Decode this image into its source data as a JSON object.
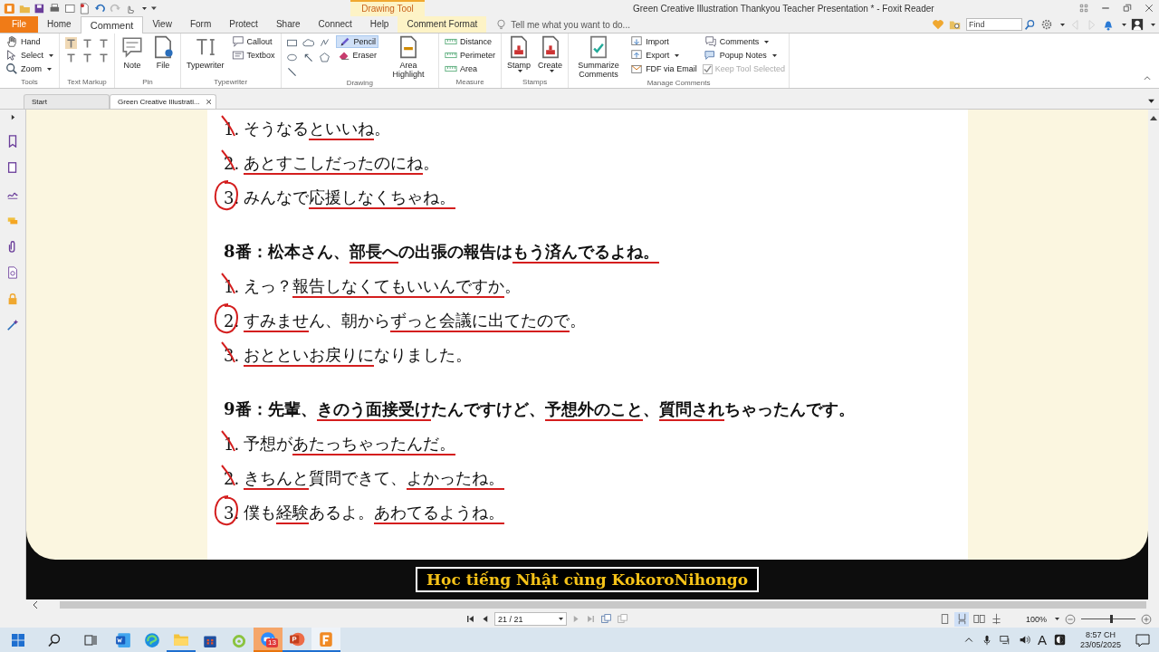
{
  "title_bar": {
    "contextual_tab": "Drawing Tool",
    "title": "Green Creative Illustration Thankyou Teacher Presentation * - Foxit Reader"
  },
  "tabs": [
    {
      "label": "File",
      "kind": "file",
      "selected": false
    },
    {
      "label": "Home",
      "kind": "tab",
      "selected": false
    },
    {
      "label": "Comment",
      "kind": "tab",
      "selected": true
    },
    {
      "label": "View",
      "kind": "tab",
      "selected": false
    },
    {
      "label": "Form",
      "kind": "tab",
      "selected": false
    },
    {
      "label": "Protect",
      "kind": "tab",
      "selected": false
    },
    {
      "label": "Share",
      "kind": "tab",
      "selected": false
    },
    {
      "label": "Connect",
      "kind": "tab",
      "selected": false
    },
    {
      "label": "Help",
      "kind": "tab",
      "selected": false
    },
    {
      "label": "Comment Format",
      "kind": "context",
      "selected": false
    }
  ],
  "tell_me": {
    "placeholder": "Tell me what you want to do..."
  },
  "find": {
    "placeholder": "Find"
  },
  "ribbon": {
    "groups": [
      {
        "label": "Tools",
        "items": [
          {
            "kind": "small",
            "label": "Hand",
            "selected": false
          },
          {
            "kind": "small",
            "label": "Select",
            "dropdown": true,
            "selected": false
          },
          {
            "kind": "small",
            "label": "Zoom",
            "dropdown": true,
            "selected": false
          }
        ]
      },
      {
        "label": "Text Markup",
        "items": [
          {
            "kind": "icon",
            "selected": false
          },
          {
            "kind": "icon",
            "selected": false
          },
          {
            "kind": "icon",
            "selected": false
          },
          {
            "kind": "icon",
            "selected": false
          },
          {
            "kind": "icon",
            "selected": false
          },
          {
            "kind": "icon",
            "selected": false
          }
        ]
      },
      {
        "label": "Pin",
        "items": [
          {
            "kind": "large",
            "label": "Note",
            "selected": false
          },
          {
            "kind": "large",
            "label": "File",
            "selected": false
          }
        ]
      },
      {
        "label": "Typewriter",
        "items": [
          {
            "kind": "large",
            "label": "Typewriter",
            "selected": false
          },
          {
            "kind": "small",
            "label": "Callout",
            "selected": false
          },
          {
            "kind": "small",
            "label": "Textbox",
            "selected": false
          }
        ]
      },
      {
        "label": "Drawing",
        "items": [
          {
            "kind": "icon",
            "selected": false
          },
          {
            "kind": "icon",
            "selected": false
          },
          {
            "kind": "icon",
            "selected": false
          },
          {
            "kind": "icon",
            "selected": false
          },
          {
            "kind": "icon",
            "selected": false
          },
          {
            "kind": "icon",
            "selected": false
          },
          {
            "kind": "icon",
            "selected": false
          },
          {
            "kind": "small",
            "label": "Pencil",
            "selected": true
          },
          {
            "kind": "small",
            "label": "Eraser",
            "selected": false
          },
          {
            "kind": "large",
            "label": "Area Highlight",
            "selected": false
          }
        ]
      },
      {
        "label": "Measure",
        "items": [
          {
            "kind": "small",
            "label": "Distance",
            "selected": false
          },
          {
            "kind": "small",
            "label": "Perimeter",
            "selected": false
          },
          {
            "kind": "small",
            "label": "Area",
            "selected": false
          }
        ]
      },
      {
        "label": "Stamps",
        "items": [
          {
            "kind": "large",
            "label": "Stamp",
            "dropdown": true,
            "selected": false
          },
          {
            "kind": "large",
            "label": "Create",
            "dropdown": true,
            "selected": false
          }
        ]
      },
      {
        "label": "Manage Comments",
        "items": [
          {
            "kind": "large",
            "label": "Summarize Comments",
            "selected": false
          },
          {
            "kind": "small",
            "label": "Import",
            "selected": false
          },
          {
            "kind": "small",
            "label": "Export",
            "dropdown": true,
            "selected": false
          },
          {
            "kind": "small",
            "label": "FDF via Email",
            "selected": false
          },
          {
            "kind": "small",
            "label": "Comments",
            "dropdown": true,
            "selected": false
          },
          {
            "kind": "small",
            "label": "Popup Notes",
            "dropdown": true,
            "selected": false
          },
          {
            "kind": "check",
            "label": "Keep Tool Selected",
            "checked": true,
            "disabled": true
          }
        ]
      }
    ]
  },
  "doc_tabs": [
    {
      "label": "Start",
      "selected": false
    },
    {
      "label": "Green Creative Illustrati...",
      "selected": true,
      "closable": true
    }
  ],
  "document": {
    "blocks": [
      {
        "options": [
          {
            "number": "1.",
            "crossed": true,
            "circled": false,
            "parts": [
              {
                "t": "そうなる"
              },
              {
                "t": "といいね",
                "u": true
              },
              {
                "t": "。"
              }
            ]
          },
          {
            "number": "2.",
            "crossed": true,
            "circled": false,
            "parts": [
              {
                "t": "あとすこしだったのにね",
                "u": true
              },
              {
                "t": "。"
              }
            ]
          },
          {
            "number": "3.",
            "crossed": false,
            "circled": true,
            "parts": [
              {
                "t": "みんなで"
              },
              {
                "t": "応援しなくちゃね。",
                "u": true
              }
            ]
          }
        ]
      },
      {
        "question": [
          {
            "t": "8番：松本さん、"
          },
          {
            "t": "部長へ",
            "u": true
          },
          {
            "t": "の出張の報告は"
          },
          {
            "t": "もう済んでるよね。",
            "u": true
          }
        ],
        "options": [
          {
            "number": "1.",
            "crossed": true,
            "circled": false,
            "parts": [
              {
                "t": "えっ？"
              },
              {
                "t": "報告し",
                "u": true
              },
              {
                "t": "なくてもいいんですか",
                "u": true
              },
              {
                "t": "。"
              }
            ]
          },
          {
            "number": "2.",
            "crossed": false,
            "circled": true,
            "parts": [
              {
                "t": "すみませ",
                "u": true
              },
              {
                "t": "ん、朝から"
              },
              {
                "t": "ずっと",
                "u": true
              },
              {
                "t": "会議に出てたので",
                "u": true
              },
              {
                "t": "。"
              }
            ]
          },
          {
            "number": "3.",
            "crossed": true,
            "circled": false,
            "parts": [
              {
                "t": "おとといお戻りに",
                "u": true
              },
              {
                "t": "なりました。"
              }
            ]
          }
        ]
      },
      {
        "question": [
          {
            "t": "9番：先輩、"
          },
          {
            "t": "きのう面接受け",
            "u": true
          },
          {
            "t": "たんですけど、"
          },
          {
            "t": "予想外のこと",
            "u": true
          },
          {
            "t": "、"
          },
          {
            "t": "質問され",
            "u": true
          },
          {
            "t": "ちゃったんです。"
          }
        ],
        "options": [
          {
            "number": "1.",
            "crossed": true,
            "circled": false,
            "parts": [
              {
                "t": "予想が"
              },
              {
                "t": "あたっちゃったんだ。",
                "u": true
              }
            ]
          },
          {
            "number": "2.",
            "crossed": true,
            "circled": false,
            "parts": [
              {
                "t": "きちんと",
                "u": true
              },
              {
                "t": "質問できて、"
              },
              {
                "t": "よかったね。",
                "u": true
              }
            ]
          },
          {
            "number": "3.",
            "crossed": false,
            "circled": true,
            "parts": [
              {
                "t": "僕も"
              },
              {
                "t": "経験",
                "u": true
              },
              {
                "t": "あるよ。"
              },
              {
                "t": "あわてるようね。",
                "u": true
              }
            ]
          }
        ]
      }
    ]
  },
  "slide_caption": "Học tiếng Nhật cùng KokoroNihongo",
  "status_bar": {
    "page": "21 / 21",
    "view_modes": [
      {
        "selected": false
      },
      {
        "selected": true
      },
      {
        "selected": false
      },
      {
        "selected": false
      }
    ],
    "zoom": "100%",
    "zoom_slider": {
      "level": 0.55
    }
  },
  "taskbar": {
    "apps": [
      {
        "running": false,
        "selected": false
      },
      {
        "running": false,
        "selected": false
      },
      {
        "running": true,
        "selected": false
      },
      {
        "running": false,
        "selected": false
      },
      {
        "running": false,
        "selected": false
      },
      {
        "running": true,
        "selected": false,
        "alert": true,
        "badge": "13"
      },
      {
        "running": true,
        "selected": false
      },
      {
        "running": true,
        "selected": true
      }
    ],
    "tray": {
      "input_indicator": "A",
      "time": "8:57 CH",
      "date": "23/05/2025"
    }
  }
}
